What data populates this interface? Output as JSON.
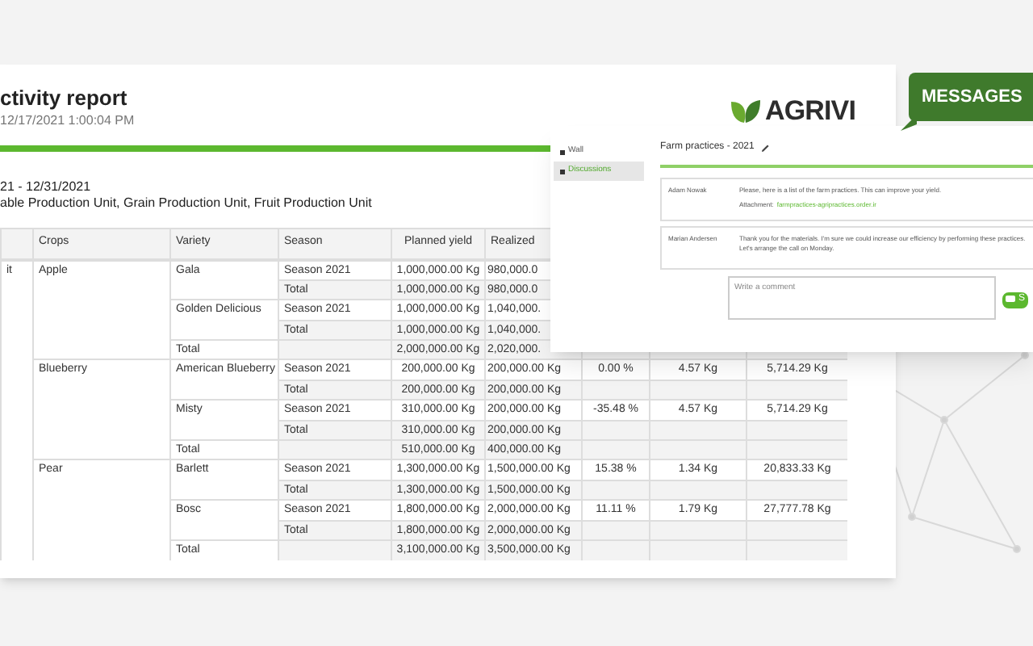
{
  "report": {
    "title": "ctivity report",
    "date": "12/17/2021 1:00:04 PM",
    "period": "21 - 12/31/2021",
    "units": "able Production Unit, Grain Production Unit, Fruit Production Unit"
  },
  "logo": {
    "text": "AGRIVI"
  },
  "messages_badge": {
    "text": "MESSAGES"
  },
  "table": {
    "columns": [
      "Crops",
      "Variety",
      "Season",
      "Planned yield",
      "Realized"
    ],
    "rows": [
      {
        "unit": "it",
        "crop": "Apple",
        "variety": "Gala",
        "season": "Season 2021",
        "planned": "1,000,000.00 Kg",
        "realized": "980,000.0"
      },
      {
        "season": "Total",
        "planned": "1,000,000.00 Kg",
        "realized": "980,000.0",
        "kind": "total"
      },
      {
        "variety": "Golden Delicious",
        "season": "Season 2021",
        "planned": "1,000,000.00 Kg",
        "realized": "1,040,000."
      },
      {
        "season": "Total",
        "planned": "1,000,000.00 Kg",
        "realized": "1,040,000.",
        "kind": "total"
      },
      {
        "variety": "Total",
        "planned": "2,000,000.00 Kg",
        "realized": "2,020,000.",
        "kind": "total"
      },
      {
        "crop": "Blueberry",
        "variety": "American Blueberry",
        "season": "Season 2021",
        "planned": "200,000.00 Kg",
        "realized": "200,000.00 Kg",
        "change": "0.00 %",
        "column_8": "4.57 Kg",
        "column_9": "5,714.29 Kg"
      },
      {
        "season": "Total",
        "planned": "200,000.00 Kg",
        "realized": "200,000.00 Kg",
        "kind": "total"
      },
      {
        "variety": "Misty",
        "season": "Season 2021",
        "planned": "310,000.00 Kg",
        "realized": "200,000.00 Kg",
        "change": "-35.48 %",
        "column_8": "4.57 Kg",
        "column_9": "5,714.29 Kg"
      },
      {
        "season": "Total",
        "planned": "310,000.00 Kg",
        "realized": "200,000.00 Kg",
        "kind": "total"
      },
      {
        "variety": "Total",
        "planned": "510,000.00 Kg",
        "realized": "400,000.00 Kg",
        "kind": "total"
      },
      {
        "crop": "Pear",
        "variety": "Barlett",
        "season": "Season 2021",
        "planned": "1,300,000.00 Kg",
        "realized": "1,500,000.00 Kg",
        "change": "15.38 %",
        "column_8": "1.34 Kg",
        "column_9": "20,833.33 Kg"
      },
      {
        "season": "Total",
        "planned": "1,300,000.00 Kg",
        "realized": "1,500,000.00 Kg",
        "kind": "total"
      },
      {
        "variety": "Bosc",
        "season": "Season 2021",
        "planned": "1,800,000.00 Kg",
        "realized": "2,000,000.00 Kg",
        "change": "11.11 %",
        "column_8": "1.79 Kg",
        "column_9": "27,777.78 Kg"
      },
      {
        "season": "Total",
        "planned": "1,800,000.00 Kg",
        "realized": "2,000,000.00 Kg",
        "kind": "total"
      },
      {
        "variety": "Total",
        "planned": "3,100,000.00 Kg",
        "realized": "3,500,000.00 Kg",
        "kind": "total"
      }
    ]
  },
  "discussion": {
    "sidebar": [
      {
        "label": "Wall",
        "selected": false
      },
      {
        "label": "Discussions",
        "selected": true
      }
    ],
    "title": "Farm practices - 2021",
    "comments": [
      {
        "author": "Adam Nowak",
        "text": "Please, here is a list of the farm practices. This can improve your yield.",
        "attachment_label": "Attachment:",
        "attachment": "farmpractices-agripractices.order.ir"
      },
      {
        "author": "Marian Andersen",
        "text": "Thank you for the materials. I'm sure we could increase our efficiency by performing these practices.",
        "text_2": "Let's arrange the call on Monday."
      }
    ],
    "comment_field": {
      "placeholder": "Write a comment"
    },
    "send_button": {
      "label": "S"
    }
  }
}
